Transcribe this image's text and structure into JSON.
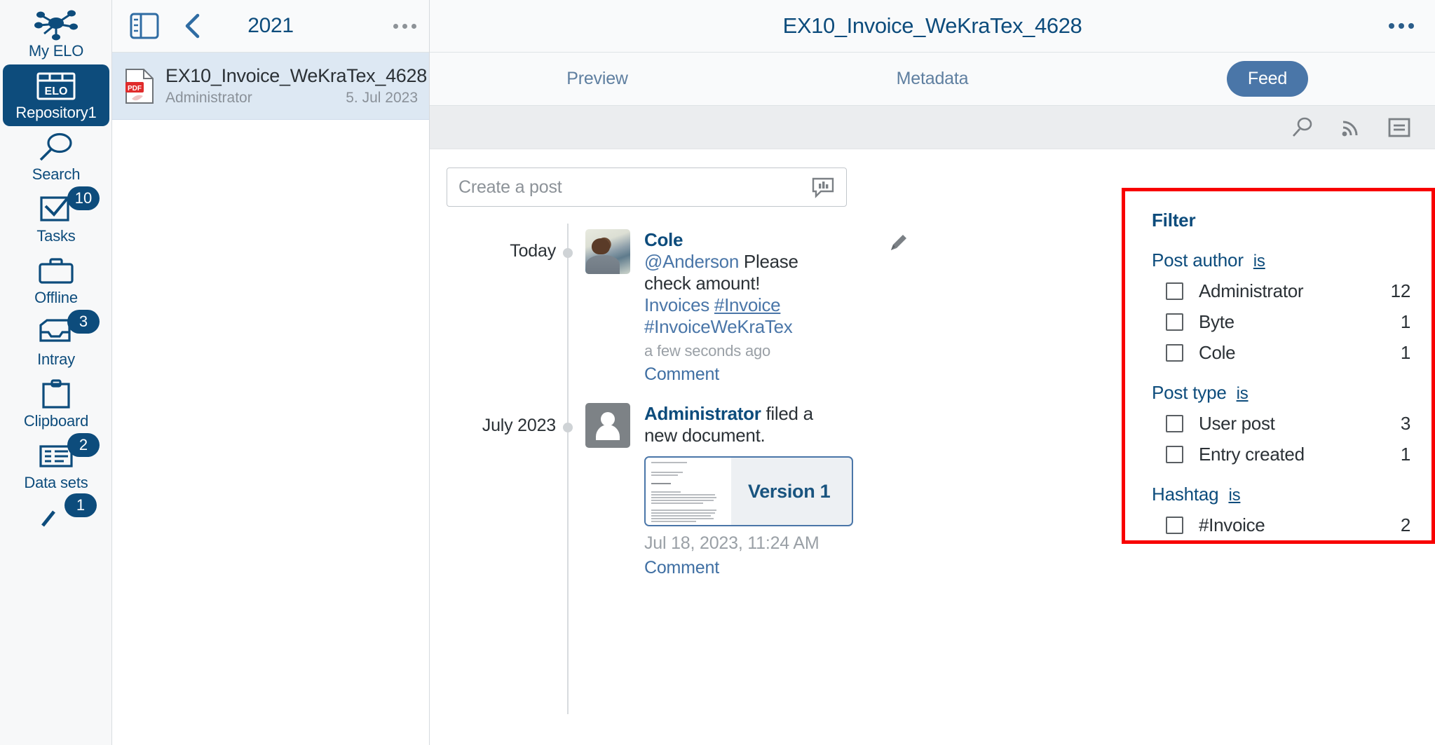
{
  "sidebar": {
    "items": [
      {
        "label": "My ELO",
        "icon": "network-icon",
        "badge": null,
        "active": false
      },
      {
        "label": "Repository1",
        "icon": "elo-repository-icon",
        "badge": null,
        "active": true
      },
      {
        "label": "Search",
        "icon": "search-icon",
        "badge": null,
        "active": false
      },
      {
        "label": "Tasks",
        "icon": "tasks-icon",
        "badge": "10",
        "active": false
      },
      {
        "label": "Offline",
        "icon": "briefcase-icon",
        "badge": null,
        "active": false
      },
      {
        "label": "Intray",
        "icon": "intray-icon",
        "badge": "3",
        "active": false
      },
      {
        "label": "Clipboard",
        "icon": "clipboard-icon",
        "badge": null,
        "active": false
      },
      {
        "label": "Data sets",
        "icon": "data-sets-icon",
        "badge": "2",
        "active": false
      },
      {
        "label": "",
        "icon": "search-partial-icon",
        "badge": "1",
        "active": false
      }
    ]
  },
  "list_panel": {
    "toolbar": {
      "panel_toggle_icon": "sidebar-toggle-icon",
      "back_icon": "chevron-left-icon",
      "title": "2021",
      "overflow_icon": "more-options-icon"
    },
    "documents": [
      {
        "icon": "pdf-file-icon",
        "title": "EX10_Invoice_WeKraTex_4628",
        "author": "Administrator",
        "date": "5. Jul 2023"
      }
    ]
  },
  "main": {
    "header": {
      "title": "EX10_Invoice_WeKraTex_4628",
      "overflow_icon": "more-options-icon"
    },
    "tabs": [
      {
        "label": "Preview",
        "active": false
      },
      {
        "label": "Metadata",
        "active": false
      },
      {
        "label": "Feed",
        "active": true
      }
    ],
    "subbar_icons": [
      {
        "name": "search-icon"
      },
      {
        "name": "rss-feed-icon"
      },
      {
        "name": "details-list-icon"
      }
    ],
    "composer": {
      "placeholder": "Create a post",
      "action_icon": "poll-bubble-icon"
    },
    "feed": [
      {
        "when": "Today",
        "avatar": "photo-avatar",
        "author": "Cole",
        "text_mention": "@Anderson",
        "text_plain": " Please check amount! ",
        "text_link": "Invoices ",
        "text_tag": "#Invoice",
        "text_tag2": "#InvoiceWeKraTex",
        "ago": "a few seconds ago",
        "comment_label": "Comment",
        "edit_icon": "edit-pencil-icon"
      },
      {
        "when": "July 2023",
        "avatar": "generic-user-avatar",
        "author": "Administrator",
        "action_text": " filed a new document.",
        "version_label": "Version 1",
        "timestamp": "Jul 18, 2023, 11:24 AM",
        "comment_label": "Comment"
      }
    ]
  },
  "filter_panel": {
    "title": "Filter",
    "highlight_color": "#f80000",
    "groups": [
      {
        "name": "Post author",
        "operator": "is",
        "options": [
          {
            "label": "Administrator",
            "count": "12",
            "checked": false
          },
          {
            "label": "Byte",
            "count": "1",
            "checked": false
          },
          {
            "label": "Cole",
            "count": "1",
            "checked": false
          }
        ]
      },
      {
        "name": "Post type",
        "operator": "is",
        "options": [
          {
            "label": "User post",
            "count": "3",
            "checked": false
          },
          {
            "label": "Entry created",
            "count": "1",
            "checked": false
          }
        ]
      },
      {
        "name": "Hashtag",
        "operator": "is",
        "options": [
          {
            "label": "#Invoice",
            "count": "2",
            "checked": false
          }
        ]
      }
    ]
  },
  "colors": {
    "brand_dark_blue": "#0d4c7c",
    "accent_blue": "#4a76a8",
    "selection_blue": "#dde8f3",
    "highlight_red": "#f80000"
  }
}
